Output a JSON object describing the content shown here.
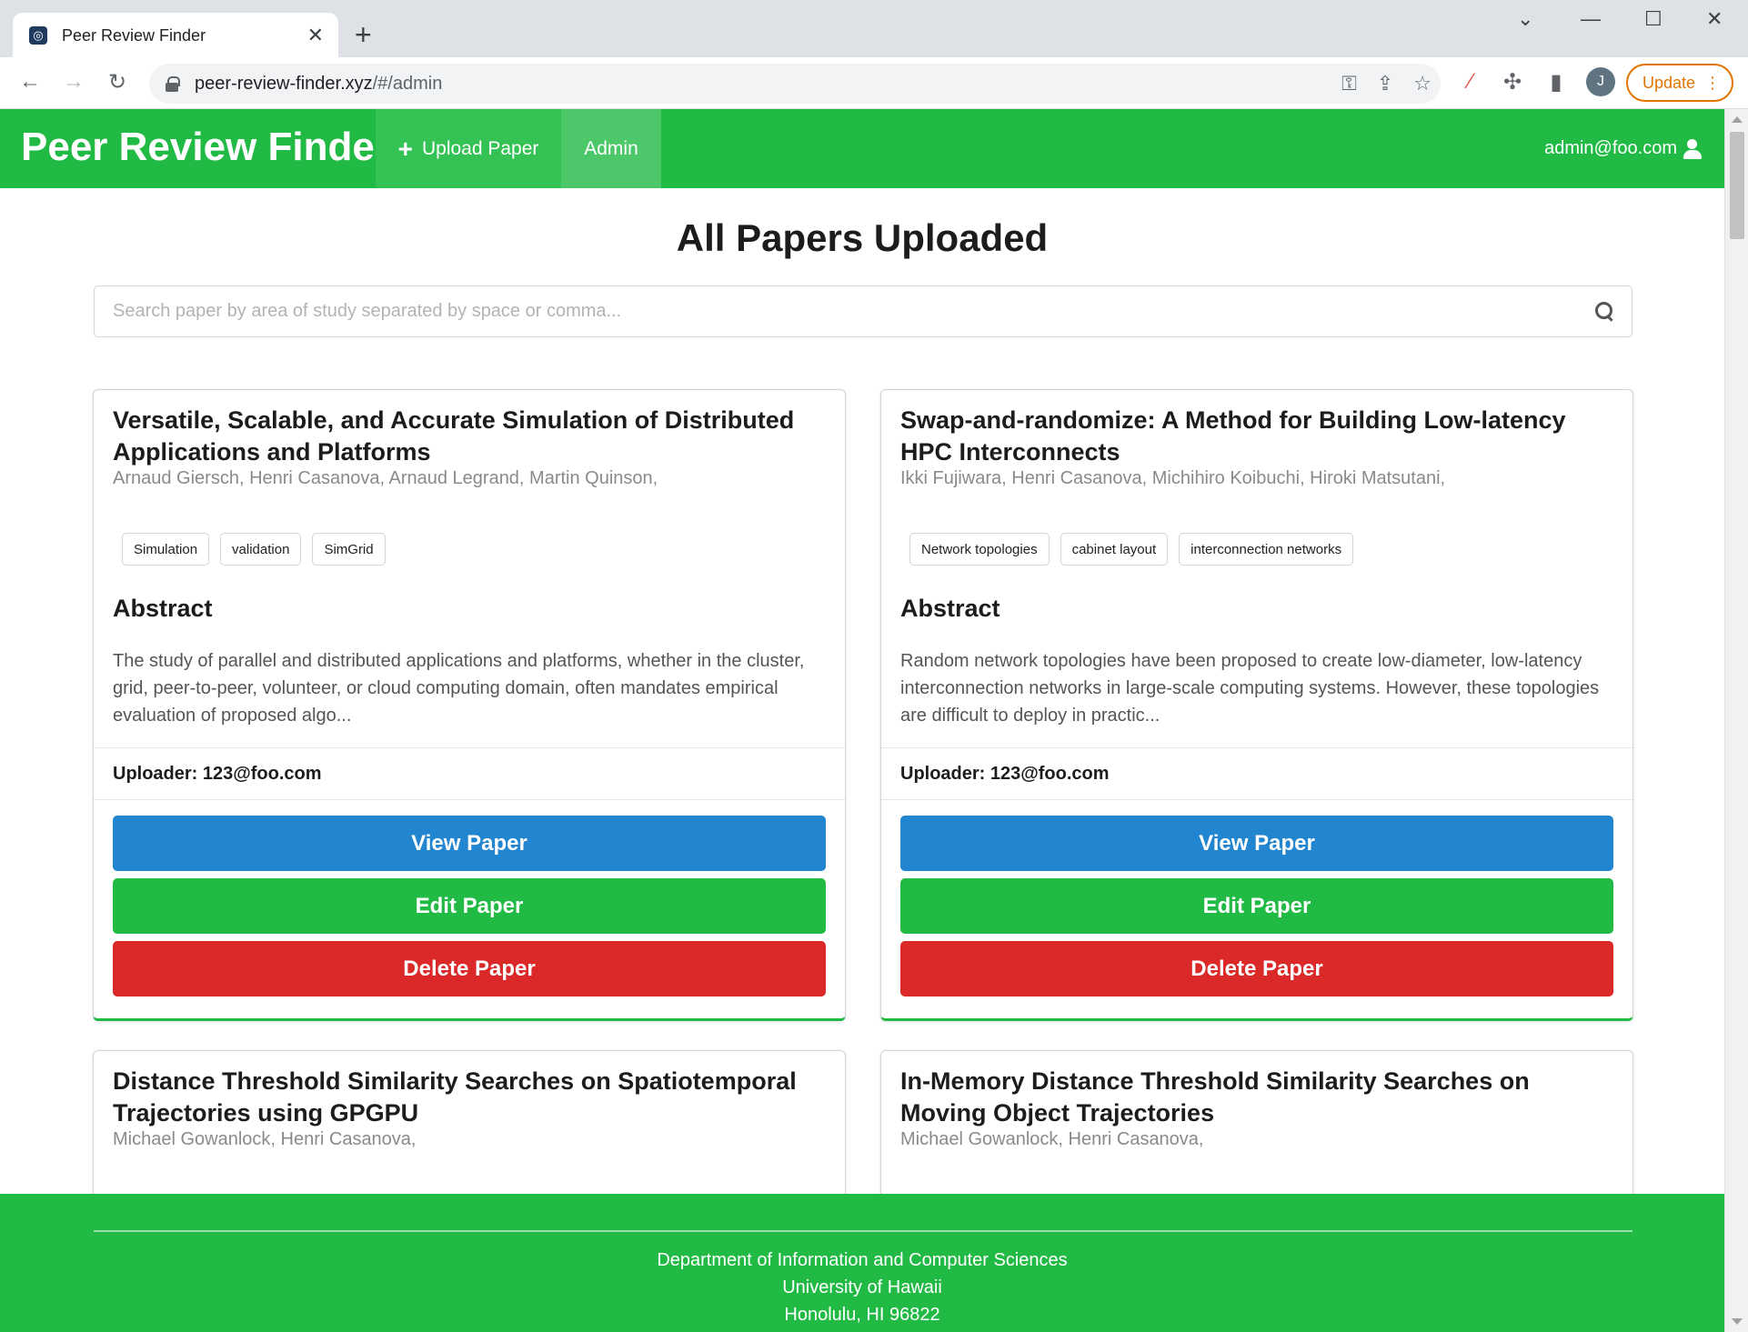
{
  "browser": {
    "tab_title": "Peer Review Finder",
    "tab_favicon": "app-favicon",
    "new_tab_label": "+",
    "url_domain": "peer-review-finder.xyz",
    "url_path": "/#/admin",
    "avatar_letter": "J",
    "update_label": "Update"
  },
  "navbar": {
    "brand": "Peer Review Finder",
    "upload_label": "Upload Paper",
    "admin_label": "Admin",
    "user_email": "admin@foo.com"
  },
  "page": {
    "heading": "All Papers Uploaded",
    "search_placeholder": "Search paper by area of study separated by space or comma..."
  },
  "labels": {
    "abstract": "Abstract",
    "view": "View Paper",
    "edit": "Edit Paper",
    "delete": "Delete Paper"
  },
  "papers": [
    {
      "title": "Versatile, Scalable, and Accurate Simulation of Distributed Applications and Platforms",
      "authors": "Arnaud Giersch, Henri Casanova, Arnaud Legrand, Martin Quinson,",
      "tags": [
        "Simulation",
        "validation",
        "SimGrid"
      ],
      "abstract": "The study of parallel and distributed applications and platforms, whether in the cluster, grid, peer-to-peer, volunteer, or cloud computing domain, often mandates empirical evaluation of proposed algo...",
      "uploader": "Uploader: 123@foo.com"
    },
    {
      "title": "Swap-and-randomize: A Method for Building Low-latency HPC Interconnects",
      "authors": "Ikki Fujiwara, Henri Casanova, Michihiro Koibuchi, Hiroki Matsutani,",
      "tags": [
        "Network topologies",
        "cabinet layout",
        "interconnection networks"
      ],
      "abstract": "Random network topologies have been proposed to create low-diameter, low-latency interconnection networks in large-scale computing systems. However, these topologies are difficult to deploy in practic...",
      "uploader": "Uploader: 123@foo.com"
    },
    {
      "title": "Distance Threshold Similarity Searches on Spatiotemporal Trajectories using GPGPU",
      "authors": "Michael Gowanlock, Henri Casanova,"
    },
    {
      "title": "In-Memory Distance Threshold Similarity Searches on Moving Object Trajectories",
      "authors": "Michael Gowanlock, Henri Casanova,"
    }
  ],
  "footer": {
    "line1": "Department of Information and Computer Sciences",
    "line2": "University of Hawaii",
    "line3": "Honolulu, HI 96822"
  },
  "colors": {
    "brand_green": "#21ba45",
    "view_blue": "#2185d0",
    "delete_red": "#db2828",
    "update_orange": "#e37400"
  }
}
